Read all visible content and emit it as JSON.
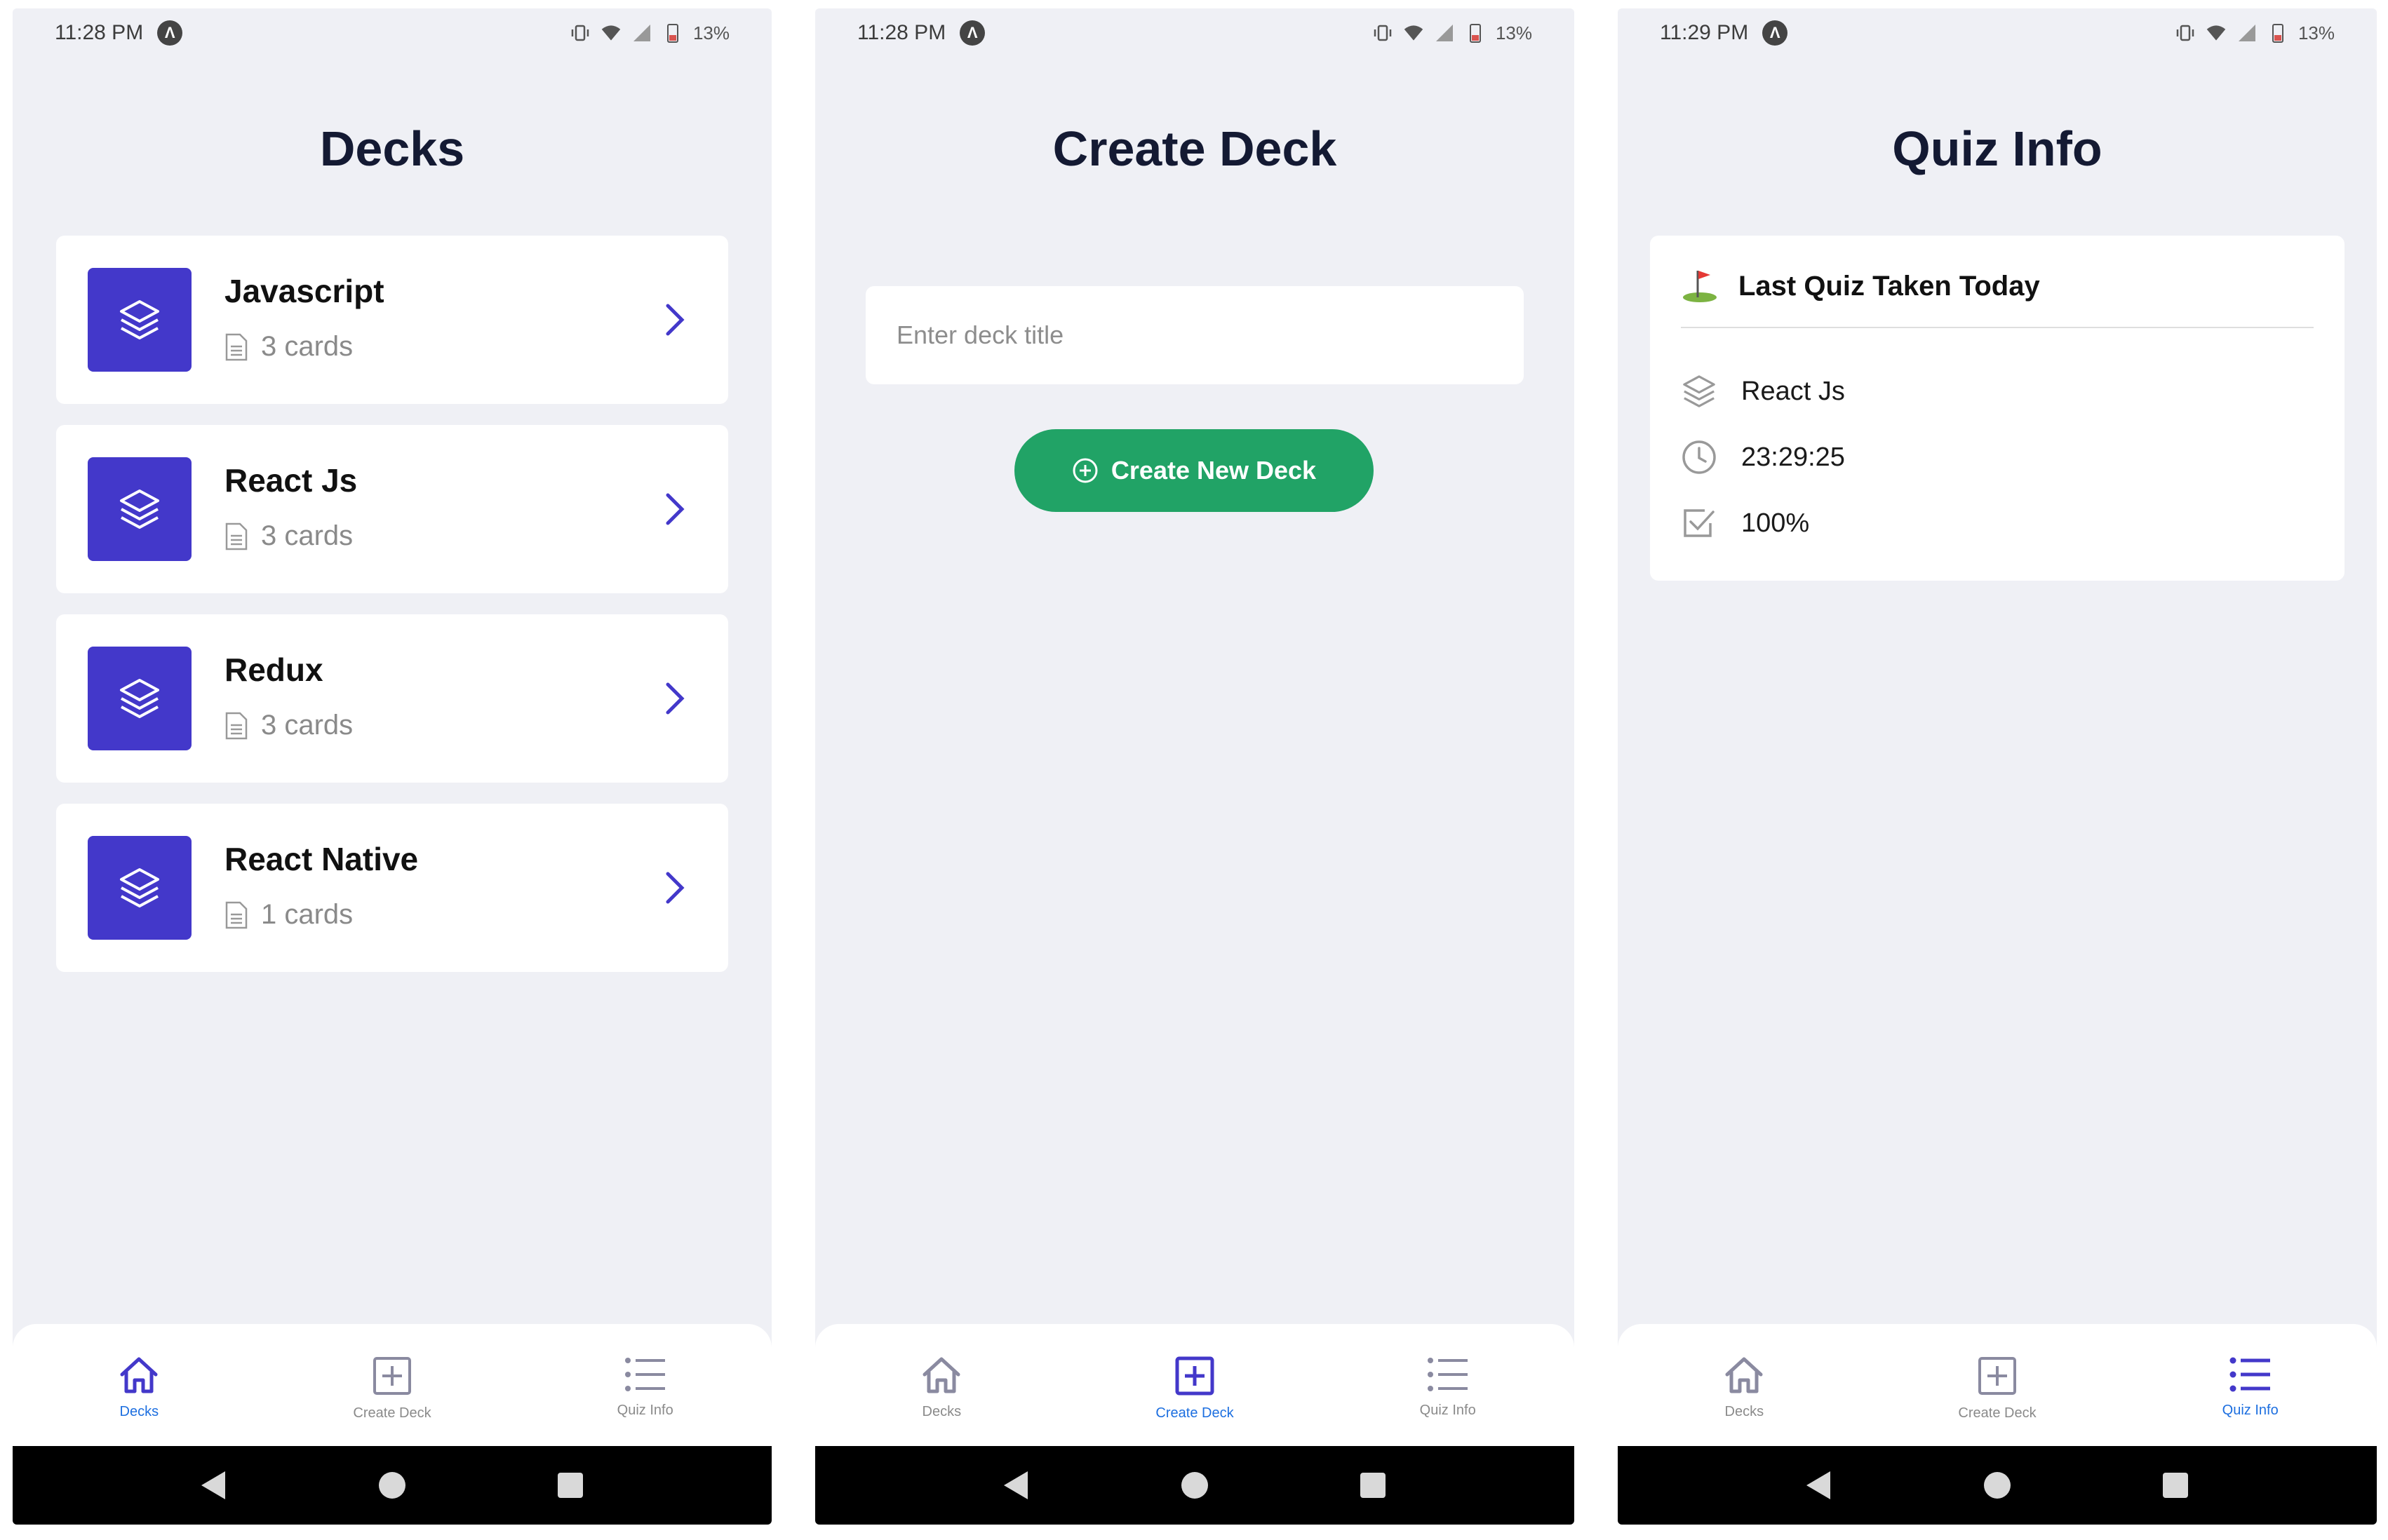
{
  "colors": {
    "accent": "#4338ca",
    "button_green": "#21a366",
    "tab_active_label": "#1d6fe0",
    "background": "#eff0f5"
  },
  "screens": [
    {
      "status": {
        "time": "11:28 PM",
        "battery": "13%"
      },
      "title": "Decks",
      "decks": [
        {
          "name": "Javascript",
          "count": "3 cards"
        },
        {
          "name": "React Js",
          "count": "3 cards"
        },
        {
          "name": "Redux",
          "count": "3 cards"
        },
        {
          "name": "React Native",
          "count": "1 cards"
        }
      ],
      "active_tab": "decks"
    },
    {
      "status": {
        "time": "11:28 PM",
        "battery": "13%"
      },
      "title": "Create Deck",
      "input_placeholder": "Enter deck title",
      "button_label": "Create New Deck",
      "active_tab": "create"
    },
    {
      "status": {
        "time": "11:29 PM",
        "battery": "13%"
      },
      "title": "Quiz Info",
      "card_title": "Last Quiz Taken Today",
      "deck_name": "React Js",
      "time_value": "23:29:25",
      "score": "100%",
      "active_tab": "quiz"
    }
  ],
  "tabs": {
    "decks_label": "Decks",
    "create_label": "Create Deck",
    "quiz_label": "Quiz Info"
  },
  "icons": {
    "deck": "layers-icon",
    "count": "document-icon",
    "chevron": "chevron-right-icon",
    "flag": "golf-flag-icon",
    "time": "clock-icon",
    "score": "checkbox-icon",
    "tab_decks": "home-icon",
    "tab_create": "plus-square-icon",
    "tab_quiz": "list-icon"
  }
}
